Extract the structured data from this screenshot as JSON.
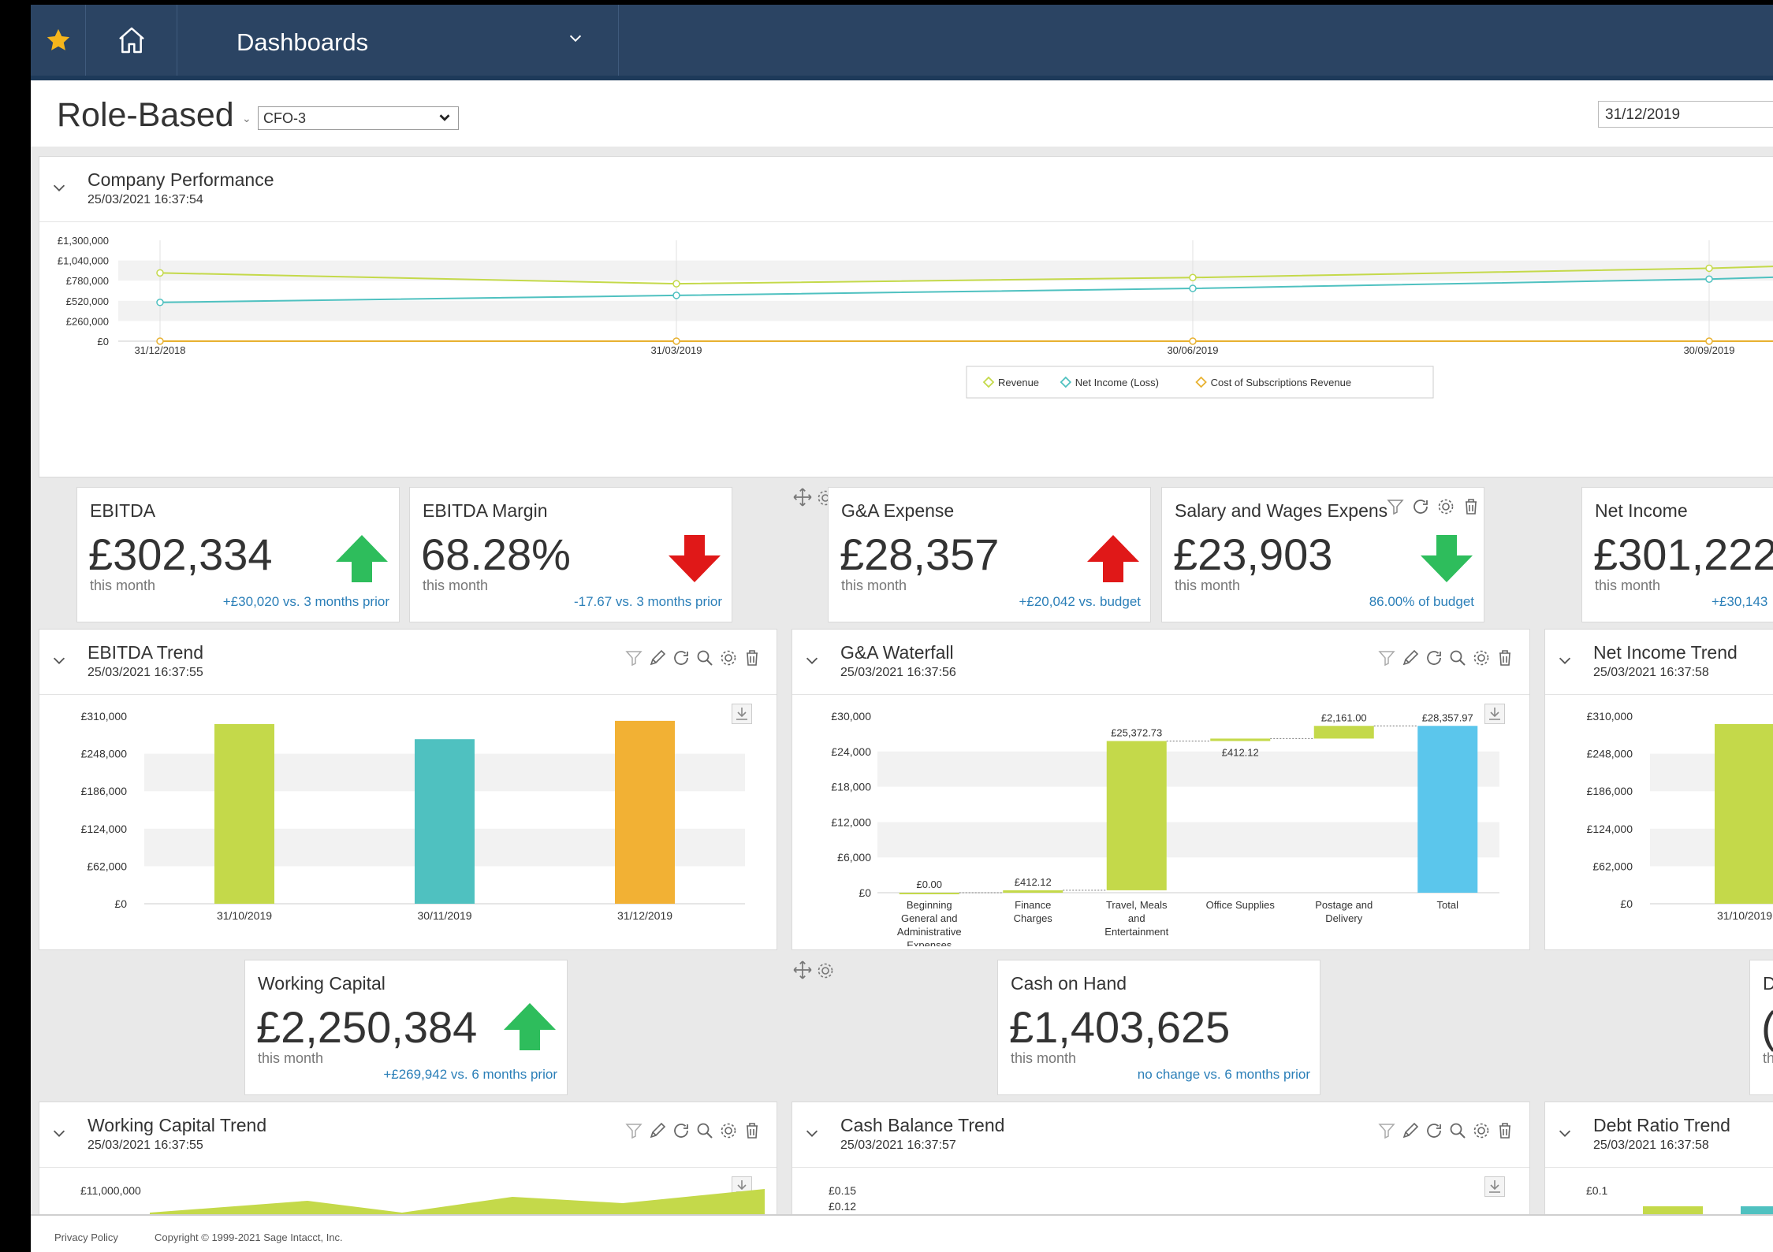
{
  "nav": {
    "title": "Dashboards"
  },
  "header": {
    "title": "Role-Based",
    "dashboard_select": "CFO-3",
    "date": "31/12/2019"
  },
  "company_performance": {
    "title": "Company Performance",
    "timestamp": "25/03/2021 16:37:54",
    "chart_data": {
      "type": "line",
      "x": [
        "31/12/2018",
        "31/03/2019",
        "30/06/2019",
        "30/09/2019"
      ],
      "y_ticks": [
        "£1,300,000",
        "£1,040,000",
        "£780,000",
        "£520,000",
        "£260,000",
        "£0"
      ],
      "ylim": [
        0,
        1300000
      ],
      "series": [
        {
          "name": "Revenue",
          "color": "#c4d94a",
          "values": [
            880000,
            740000,
            820000,
            940000
          ]
        },
        {
          "name": "Net Income (Loss)",
          "color": "#4fc1c0",
          "values": [
            500000,
            590000,
            680000,
            800000
          ]
        },
        {
          "name": "Cost of Subscriptions Revenue",
          "color": "#e8b130",
          "values": [
            0,
            0,
            0,
            0
          ]
        }
      ],
      "legend_position": "bottom-center"
    }
  },
  "kpis": {
    "ebitda": {
      "title": "EBITDA",
      "value": "£302,334",
      "sub": "this month",
      "comparison": "+£30,020 vs. 3 months prior",
      "direction": "up",
      "color": "#2ebd5c"
    },
    "ebitda_margin": {
      "title": "EBITDA Margin",
      "value": "68.28%",
      "sub": "this month",
      "comparison": "-17.67 vs. 3 months prior",
      "direction": "down",
      "color": "#e01818"
    },
    "ga_expense": {
      "title": "G&A Expense",
      "value": "£28,357",
      "sub": "this month",
      "comparison": "+£20,042 vs. budget",
      "direction": "up",
      "color": "#e01818"
    },
    "salary": {
      "title": "Salary and Wages Expens",
      "value": "£23,903",
      "sub": "this month",
      "comparison": "86.00% of budget",
      "direction": "down",
      "color": "#2ebd5c"
    },
    "net_income": {
      "title": "Net Income",
      "value": "£301,222",
      "sub": "this month",
      "comparison": "+£30,143"
    },
    "working_capital": {
      "title": "Working Capital",
      "value": "£2,250,384",
      "sub": "this month",
      "comparison": "+£269,942 vs. 6 months prior",
      "direction": "up",
      "color": "#2ebd5c"
    },
    "cash_on_hand": {
      "title": "Cash on Hand",
      "value": "£1,403,625",
      "sub": "this month",
      "comparison": "no change vs. 6 months prior"
    },
    "partial": {
      "title": "D",
      "value": "(",
      "sub": "th"
    }
  },
  "ebitda_trend": {
    "title": "EBITDA Trend",
    "timestamp": "25/03/2021 16:37:55",
    "chart_data": {
      "type": "bar",
      "categories": [
        "31/10/2019",
        "30/11/2019",
        "31/12/2019"
      ],
      "values": [
        297000,
        272000,
        302334
      ],
      "colors": [
        "#c4d94a",
        "#4fc1c0",
        "#f2b134"
      ],
      "y_ticks": [
        "£310,000",
        "£248,000",
        "£186,000",
        "£124,000",
        "£62,000",
        "£0"
      ],
      "ylim": [
        0,
        310000
      ]
    }
  },
  "ga_waterfall": {
    "title": "G&A Waterfall",
    "timestamp": "25/03/2021 16:37:56",
    "chart_data": {
      "type": "bar",
      "categories": [
        "Beginning General and Administrative Expenses",
        "Finance Charges",
        "Travel, Meals and Entertainment",
        "Office Supplies",
        "Postage and Delivery",
        "Total"
      ],
      "category_lines": [
        [
          "Beginning",
          "General and",
          "Administrative",
          "Expenses"
        ],
        [
          "Finance",
          "Charges"
        ],
        [
          "Travel, Meals",
          "and",
          "Entertainment"
        ],
        [
          "Office Supplies"
        ],
        [
          "Postage and",
          "Delivery"
        ],
        [
          "Total"
        ]
      ],
      "values": [
        0.0,
        412.12,
        25372.73,
        412.12,
        2161.0,
        28357.97
      ],
      "labels": [
        "£0.00",
        "£412.12",
        "£25,372.73",
        "£412.12",
        "£2,161.00",
        "£28,357.97"
      ],
      "y_ticks": [
        "£30,000",
        "£24,000",
        "£18,000",
        "£12,000",
        "£6,000",
        "£0"
      ],
      "ylim": [
        0,
        30000
      ],
      "colors": {
        "step": "#c4d94a",
        "total": "#5bc6ec"
      }
    }
  },
  "net_income_trend": {
    "title": "Net Income Trend",
    "timestamp": "25/03/2021 16:37:58",
    "chart_data": {
      "type": "bar",
      "categories": [
        "31/10/2019"
      ],
      "values": [
        297000
      ],
      "y_ticks": [
        "£310,000",
        "£248,000",
        "£186,000",
        "£124,000",
        "£62,000",
        "£0"
      ],
      "ylim": [
        0,
        310000
      ]
    }
  },
  "working_capital_trend": {
    "title": "Working Capital Trend",
    "timestamp": "25/03/2021 16:37:55",
    "y_top": "£11,000,000"
  },
  "cash_balance_trend": {
    "title": "Cash Balance Trend",
    "timestamp": "25/03/2021 16:37:57",
    "y_ticks": [
      "£0.15",
      "£0.12"
    ]
  },
  "debt_ratio_trend": {
    "title": "Debt Ratio Trend",
    "timestamp": "25/03/2021 16:37:58",
    "y_top": "£0.1"
  },
  "footer": {
    "privacy": "Privacy Policy",
    "copyright": "Copyright © 1999-2021 Sage Intacct, Inc."
  }
}
